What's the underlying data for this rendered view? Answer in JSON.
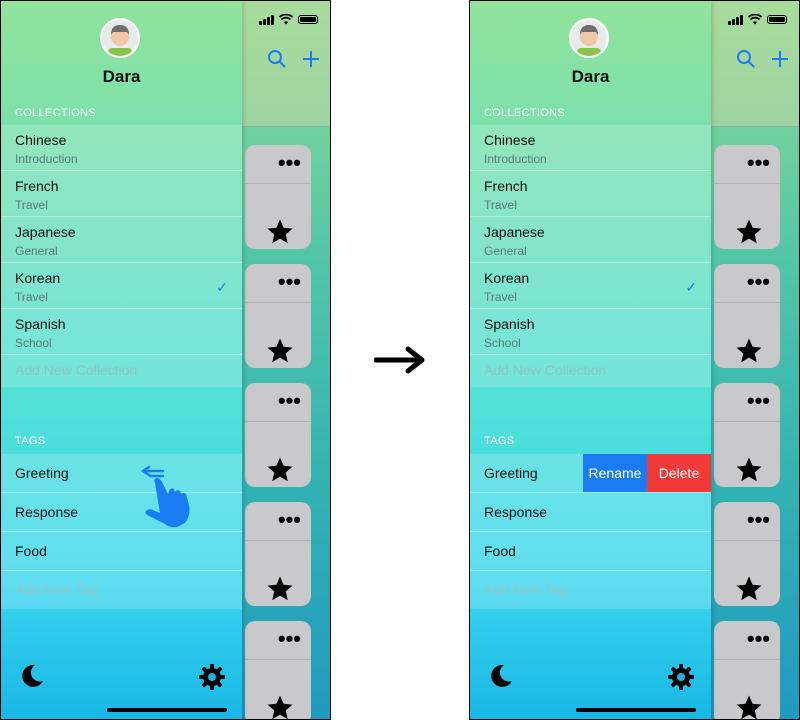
{
  "user": {
    "name": "Dara"
  },
  "collections": {
    "header": "COLLECTIONS",
    "items": [
      {
        "name": "Chinese",
        "subtitle": "Introduction",
        "selected": false
      },
      {
        "name": "French",
        "subtitle": "Travel",
        "selected": false
      },
      {
        "name": "Japanese",
        "subtitle": "General",
        "selected": false
      },
      {
        "name": "Korean",
        "subtitle": "Travel",
        "selected": true
      },
      {
        "name": "Spanish",
        "subtitle": "School",
        "selected": false
      }
    ],
    "add_label": "Add New Collection"
  },
  "tags": {
    "header": "TAGS",
    "items": [
      "Greeting",
      "Response",
      "Food"
    ],
    "add_label": "Add New Tag"
  },
  "swipe_actions": {
    "rename": "Rename",
    "delete": "Delete"
  },
  "colors": {
    "accent": "#1a7cf2",
    "delete": "#f23a3a",
    "rename": "#1a7cf2"
  },
  "icons": {
    "header": [
      "search-icon",
      "plus-icon"
    ],
    "bottom": [
      "moon-icon",
      "gear-icon"
    ],
    "card": [
      "ellipsis-icon",
      "star-icon"
    ],
    "gesture": "swipe-left-hand-icon",
    "transition": "right-arrow-icon"
  }
}
